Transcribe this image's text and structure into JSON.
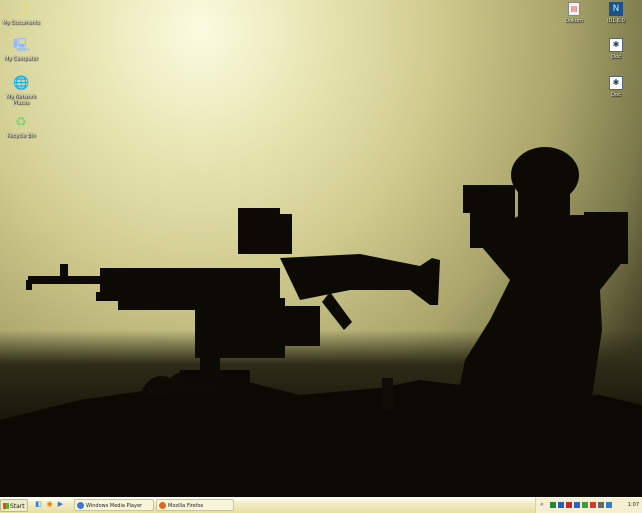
{
  "desktop": {
    "left_icons": [
      {
        "name": "my-documents-icon",
        "label": "My Documents"
      },
      {
        "name": "my-computer-icon",
        "label": "My Computer"
      },
      {
        "name": "network-places-icon",
        "label": "My Network Places"
      },
      {
        "name": "recycle-bin-icon",
        "label": "Recycle Bin"
      }
    ],
    "right_icons": [
      {
        "name": "file-icon",
        "label": "Dokum"
      },
      {
        "name": "app-shortcut-icon",
        "label": "IDL 6.0"
      },
      {
        "name": "document-file-icon",
        "label": "Doc"
      },
      {
        "name": "document-file-icon-2",
        "label": "Doc"
      }
    ]
  },
  "taskbar": {
    "start_label": "Start",
    "windows": [
      {
        "label": "Windows Media Player",
        "icon": "media-player-icon"
      },
      {
        "label": "Mozilla Firefox",
        "icon": "firefox-icon"
      }
    ],
    "clock": "1:07"
  }
}
